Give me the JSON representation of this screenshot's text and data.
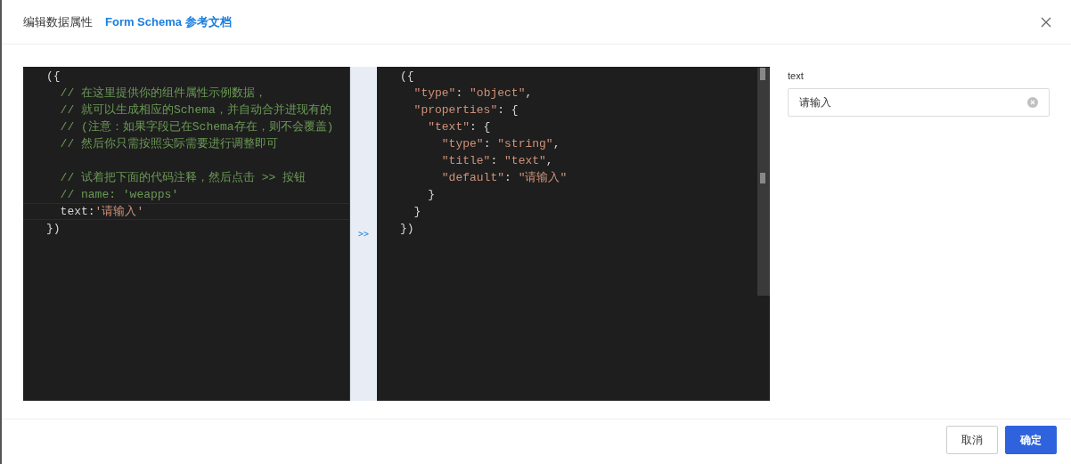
{
  "dialog": {
    "title": "编辑数据属性",
    "doc_link": "Form Schema 参考文档"
  },
  "source_editor": {
    "lines": [
      {
        "current": false,
        "tokens": [
          {
            "kind": "punct",
            "text": "({"
          }
        ]
      },
      {
        "current": false,
        "tokens": [
          {
            "kind": "comment",
            "text": "  // 在这里提供你的组件属性示例数据，"
          }
        ]
      },
      {
        "current": false,
        "tokens": [
          {
            "kind": "comment",
            "text": "  // 就可以生成相应的Schema，并自动合并进现有的"
          }
        ]
      },
      {
        "current": false,
        "tokens": [
          {
            "kind": "comment",
            "text": "  // (注意：如果字段已在Schema存在，则不会覆盖)"
          }
        ]
      },
      {
        "current": false,
        "tokens": [
          {
            "kind": "comment",
            "text": "  // 然后你只需按照实际需要进行调整即可"
          }
        ]
      },
      {
        "current": false
      },
      {
        "current": false,
        "tokens": [
          {
            "kind": "comment",
            "text": "  // 试着把下面的代码注释，然后点击 >> 按钮"
          }
        ]
      },
      {
        "current": false,
        "tokens": [
          {
            "kind": "comment",
            "text": "  // name: 'weapps'"
          }
        ]
      },
      {
        "current": true,
        "tokens": [
          {
            "kind": "plain",
            "text": "  text:"
          },
          {
            "kind": "string",
            "text": "'请输入'"
          }
        ]
      },
      {
        "current": false,
        "tokens": [
          {
            "kind": "punct",
            "text": "})"
          }
        ]
      }
    ]
  },
  "convert_button": ">>",
  "schema_editor": {
    "lines": [
      {
        "tokens": [
          {
            "kind": "punct",
            "text": "({"
          }
        ]
      },
      {
        "tokens": [
          {
            "kind": "string",
            "text": "  \"type\""
          },
          {
            "kind": "punct",
            "text": ": "
          },
          {
            "kind": "string",
            "text": "\"object\""
          },
          {
            "kind": "punct",
            "text": ","
          }
        ]
      },
      {
        "tokens": [
          {
            "kind": "string",
            "text": "  \"properties\""
          },
          {
            "kind": "punct",
            "text": ": {"
          }
        ]
      },
      {
        "tokens": [
          {
            "kind": "string",
            "text": "    \"text\""
          },
          {
            "kind": "punct",
            "text": ": {"
          }
        ]
      },
      {
        "tokens": [
          {
            "kind": "string",
            "text": "      \"type\""
          },
          {
            "kind": "punct",
            "text": ": "
          },
          {
            "kind": "string",
            "text": "\"string\""
          },
          {
            "kind": "punct",
            "text": ","
          }
        ]
      },
      {
        "tokens": [
          {
            "kind": "string",
            "text": "      \"title\""
          },
          {
            "kind": "punct",
            "text": ": "
          },
          {
            "kind": "string",
            "text": "\"text\""
          },
          {
            "kind": "punct",
            "text": ","
          }
        ]
      },
      {
        "tokens": [
          {
            "kind": "string",
            "text": "      \"default\""
          },
          {
            "kind": "punct",
            "text": ": "
          },
          {
            "kind": "string",
            "text": "\"请输入\""
          }
        ]
      },
      {
        "tokens": [
          {
            "kind": "punct",
            "text": "    }"
          }
        ]
      },
      {
        "tokens": [
          {
            "kind": "punct",
            "text": "  }"
          }
        ]
      },
      {
        "tokens": [
          {
            "kind": "punct",
            "text": "})"
          }
        ]
      }
    ]
  },
  "preview_form": {
    "fields": [
      {
        "label": "text",
        "value": "请输入"
      }
    ]
  },
  "footer": {
    "buttons": [
      {
        "label": "取消",
        "kind": "default"
      },
      {
        "label": "确定",
        "kind": "primary"
      }
    ]
  }
}
